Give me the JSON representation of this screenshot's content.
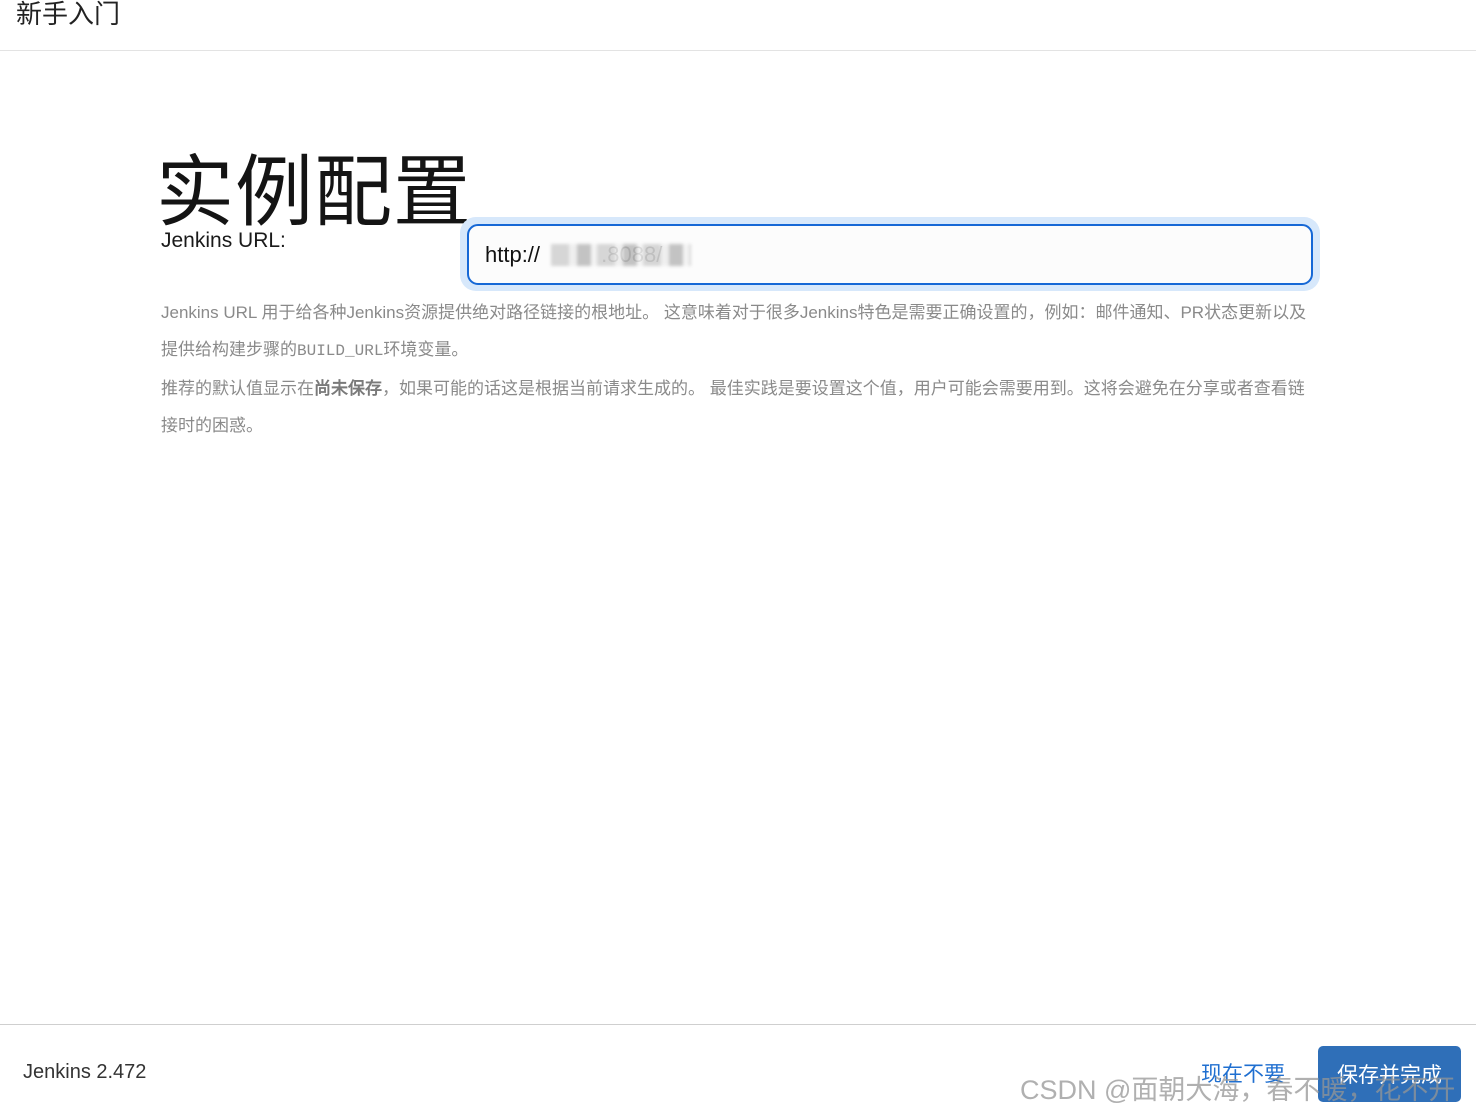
{
  "topbar": {
    "title": "新手入门"
  },
  "page": {
    "heading": "实例配置"
  },
  "form": {
    "label": "Jenkins URL:",
    "url_value": "http://          .8088/"
  },
  "help": {
    "p1_text": "Jenkins URL 用于给各种Jenkins资源提供绝对路径链接的根地址。 这意味着对于很多Jenkins特色是需要正确设置的，例如：邮件通知、PR状态更新以及提供给构建步骤的",
    "p1_code": "BUILD_URL",
    "p1_tail": "环境变量。",
    "p2_prefix": "推荐的默认值显示在",
    "p2_strong": "尚未保存",
    "p2_suffix": "，如果可能的话这是根据当前请求生成的。 最佳实践是要设置这个值，用户可能会需要用到。这将会避免在分享或者查看链接时的困惑。"
  },
  "footer": {
    "version": "Jenkins 2.472",
    "skip_label": "现在不要",
    "save_label": "保存并完成"
  },
  "watermark": "CSDN @面朝大海，春不暖，花不开",
  "colors": {
    "accent": "#1668d6",
    "button": "#2f6fb8",
    "link": "#1f6fd0"
  }
}
